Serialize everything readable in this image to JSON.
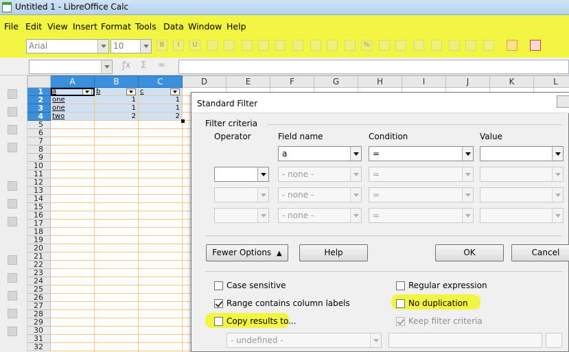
{
  "window": {
    "title": "Untitled 1 - LibreOffice Calc"
  },
  "menu": [
    {
      "label": "File"
    },
    {
      "label": "Edit"
    },
    {
      "label": "View"
    },
    {
      "label": "Insert"
    },
    {
      "label": "Format"
    },
    {
      "label": "Tools"
    },
    {
      "label": "Data"
    },
    {
      "label": "Window"
    },
    {
      "label": "Help"
    }
  ],
  "toolbar": {
    "font_name": "Arial",
    "font_size": "10"
  },
  "sheet": {
    "columns": [
      "A",
      "B",
      "C",
      "D",
      "E",
      "F",
      "G",
      "H",
      "I",
      "J",
      "K",
      "L"
    ],
    "rows": [
      "1",
      "2",
      "3",
      "4",
      "5",
      "6",
      "7",
      "8",
      "9",
      "10",
      "11",
      "12",
      "13",
      "14",
      "15",
      "16",
      "17",
      "18",
      "19",
      "20",
      "21",
      "22",
      "23",
      "24",
      "25",
      "26",
      "27",
      "28",
      "29",
      "30",
      "31",
      "32"
    ],
    "data": [
      [
        "a",
        "b",
        "c"
      ],
      [
        "one",
        "1",
        "1"
      ],
      [
        "one",
        "1",
        "1"
      ],
      [
        "two",
        "2",
        "2"
      ]
    ]
  },
  "dialog": {
    "title": "Standard Filter",
    "criteria_label": "Filter criteria",
    "headers": {
      "operator": "Operator",
      "field": "Field name",
      "condition": "Condition",
      "value": "Value"
    },
    "rows": [
      {
        "operator": "",
        "field": "a",
        "condition": "=",
        "value": ""
      },
      {
        "operator": "",
        "field": "- none -",
        "condition": "=",
        "value": ""
      },
      {
        "operator": "",
        "field": "- none -",
        "condition": "=",
        "value": ""
      },
      {
        "operator": "",
        "field": "- none -",
        "condition": "=",
        "value": ""
      }
    ],
    "buttons": {
      "fewer_options": "Fewer Options",
      "help": "Help",
      "ok": "OK",
      "cancel": "Cancel"
    },
    "options": {
      "case_sensitive": "Case sensitive",
      "range_labels": "Range contains column labels",
      "copy_results": "Copy results to...",
      "regular_expression": "Regular expression",
      "no_duplication": "No duplication",
      "keep_filter": "Keep filter criteria"
    },
    "copy_target": "- undefined -",
    "highlight_color": "#f2f542"
  }
}
